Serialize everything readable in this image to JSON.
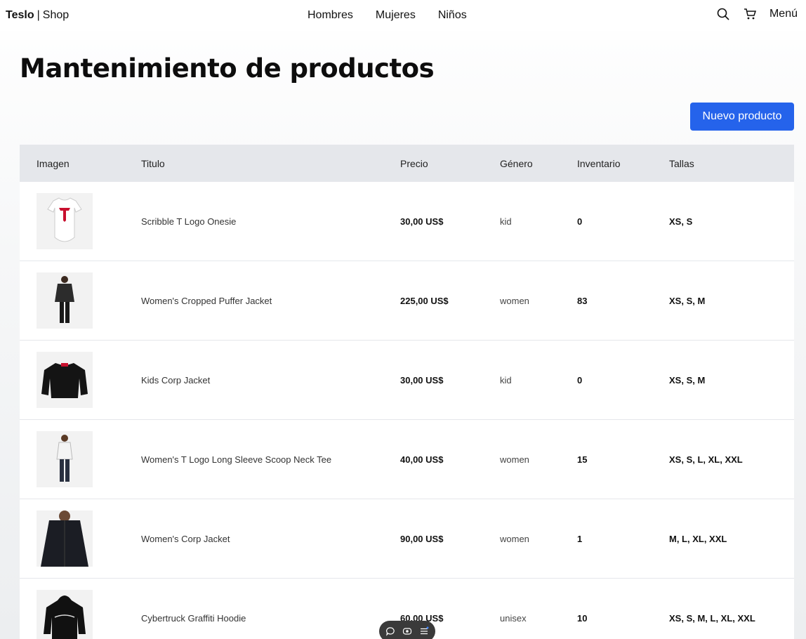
{
  "nav": {
    "brand_bold": "Teslo",
    "brand_sep": "|",
    "brand_rest": "Shop",
    "links": [
      "Hombres",
      "Mujeres",
      "Niños"
    ],
    "menu_label": "Menú",
    "icons": [
      "search-icon",
      "cart-icon"
    ]
  },
  "page": {
    "title": "Mantenimiento de productos",
    "new_button": "Nuevo producto",
    "accent": "#2563eb"
  },
  "table": {
    "headers": [
      "Imagen",
      "Titulo",
      "Precio",
      "Género",
      "Inventario",
      "Tallas"
    ],
    "rows": [
      {
        "title": "Scribble T Logo Onesie",
        "price": "30,00 US$",
        "gender": "kid",
        "inventory": "0",
        "sizes": "XS, S",
        "image": "onesie"
      },
      {
        "title": "Women's Cropped Puffer Jacket",
        "price": "225,00 US$",
        "gender": "women",
        "inventory": "83",
        "sizes": "XS, S, M",
        "image": "woman-puffer"
      },
      {
        "title": "Kids Corp Jacket",
        "price": "30,00 US$",
        "gender": "kid",
        "inventory": "0",
        "sizes": "XS, S, M",
        "image": "kids-jacket"
      },
      {
        "title": "Women's T Logo Long Sleeve Scoop Neck Tee",
        "price": "40,00 US$",
        "gender": "women",
        "inventory": "15",
        "sizes": "XS, S, L, XL, XXL",
        "image": "woman-tee"
      },
      {
        "title": "Women's Corp Jacket",
        "price": "90,00 US$",
        "gender": "women",
        "inventory": "1",
        "sizes": "M, L, XL, XXL",
        "image": "corp-jacket"
      },
      {
        "title": "Cybertruck Graffiti Hoodie",
        "price": "60,00 US$",
        "gender": "unisex",
        "inventory": "10",
        "sizes": "XS, S, M, L, XL, XXL",
        "image": "hoodie"
      }
    ]
  },
  "toolbar": {
    "icons": [
      "comment-icon",
      "eye-icon",
      "list-icon"
    ]
  }
}
